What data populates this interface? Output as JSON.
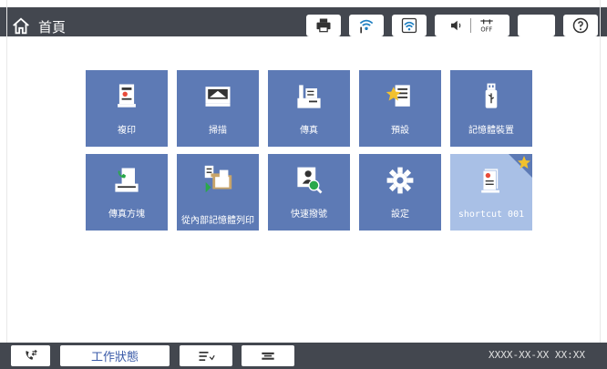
{
  "header": {
    "title": "首頁"
  },
  "tiles": [
    {
      "label": "複印",
      "icon": "copy-icon"
    },
    {
      "label": "掃描",
      "icon": "scan-icon"
    },
    {
      "label": "傳真",
      "icon": "fax-icon"
    },
    {
      "label": "預設",
      "icon": "presets-icon"
    },
    {
      "label": "記憶體裝置",
      "icon": "memory-device-icon"
    },
    {
      "label": "傳真方塊",
      "icon": "fax-box-icon"
    },
    {
      "label": "從內部記憶體列印",
      "icon": "print-from-memory-icon"
    },
    {
      "label": "快速撥號",
      "icon": "speed-dial-icon"
    },
    {
      "label": "設定",
      "icon": "settings-icon"
    },
    {
      "label": "shortcut 001",
      "icon": "shortcut-icon"
    }
  ],
  "footer": {
    "job_status_label": "工作狀態",
    "datetime": "XXXX-XX-XX XX:XX"
  },
  "colors": {
    "tile": "#5d7ab5",
    "shortcut_tile": "#a9c0e6",
    "bar": "#43474f"
  }
}
